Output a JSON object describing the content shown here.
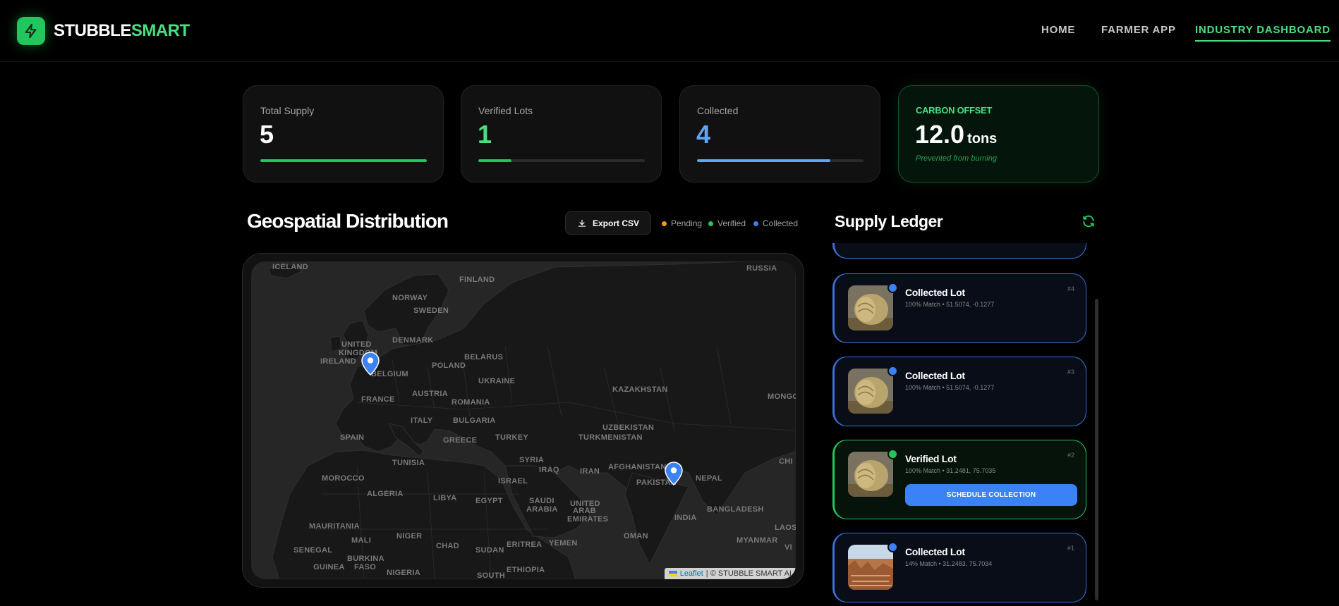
{
  "header": {
    "brand_part1": "STUBBLE",
    "brand_part2": "SMART",
    "nav": [
      {
        "label": "HOME"
      },
      {
        "label": "FARMER APP"
      },
      {
        "label": "INDUSTRY DASHBOARD",
        "active": true
      }
    ]
  },
  "stats": {
    "total_supply": {
      "label": "Total Supply",
      "value": "5",
      "progress": 1.0,
      "color": "#22c55e"
    },
    "verified_lots": {
      "label": "Verified Lots",
      "value": "1",
      "progress": 0.2,
      "color": "#22c55e"
    },
    "collected": {
      "label": "Collected",
      "value": "4",
      "progress": 0.8,
      "color": "#60a5fa"
    },
    "carbon_offset": {
      "label": "CARBON OFFSET",
      "value": "12.0",
      "unit": "tons",
      "subtitle": "Prevented from burning"
    }
  },
  "geo": {
    "title": "Geospatial Distribution",
    "export_label": "Export CSV",
    "legend": [
      {
        "label": "Pending",
        "color": "#f59e0b"
      },
      {
        "label": "Verified",
        "color": "#22c55e"
      },
      {
        "label": "Collected",
        "color": "#3b82f6"
      }
    ],
    "map_labels": [
      "ICELAND",
      "FINLAND",
      "RUSSIA",
      "NORWAY",
      "SWEDEN",
      "DENMARK",
      "UNITED",
      "KINGDOM",
      "IRELAND",
      "BELARUS",
      "POLAND",
      "BELGIUM",
      "UKRAINE",
      "KAZAKHSTAN",
      "AUSTRIA",
      "FRANCE",
      "ROMANIA",
      "MONGO",
      "ITALY",
      "BULGARIA",
      "UZBEKISTAN",
      "SPAIN",
      "TURKMENISTAN",
      "GREECE",
      "TURKEY",
      "TUNISIA",
      "SYRIA",
      "IRAQ",
      "CHI",
      "IRAN",
      "AFGHANISTAN",
      "MOROCCO",
      "ISRAEL",
      "PAKISTAN",
      "NEPAL",
      "ALGERIA",
      "LIBYA",
      "EGYPT",
      "SAUDI",
      "ARABIA",
      "UNITED",
      "ARAB",
      "EMIRATES",
      "BANGLADESH",
      "INDIA",
      "MAURITANIA",
      "MALI",
      "NIGER",
      "OMAN",
      "MYANMAR",
      "LAOS",
      "SENEGAL",
      "CHAD",
      "SUDAN",
      "ERITREA",
      "YEMEN",
      "VI",
      "BURKINA",
      "FASO",
      "GUINEA",
      "NIGERIA",
      "ETHIOPIA",
      "SOUTH"
    ],
    "attribution_link": "Leaflet",
    "attribution_text": "| © STUBBLE SMART AI"
  },
  "ledger": {
    "title": "Supply Ledger",
    "items": [
      {
        "title": "Collected Lot",
        "meta": "100% Match • 51.5074, -0.1277",
        "num": "#4",
        "status": "collected",
        "dot_color": "#3b82f6"
      },
      {
        "title": "Collected Lot",
        "meta": "100% Match • 51.5074, -0.1277",
        "num": "#3",
        "status": "collected",
        "dot_color": "#3b82f6"
      },
      {
        "title": "Verified Lot",
        "meta": "100% Match • 31.2481, 75.7035",
        "num": "#2",
        "status": "verified",
        "dot_color": "#22c55e",
        "action": "SCHEDULE COLLECTION"
      },
      {
        "title": "Collected Lot",
        "meta": "14% Match • 31.2483, 75.7034",
        "num": "#1",
        "status": "collected",
        "dot_color": "#3b82f6"
      }
    ]
  }
}
